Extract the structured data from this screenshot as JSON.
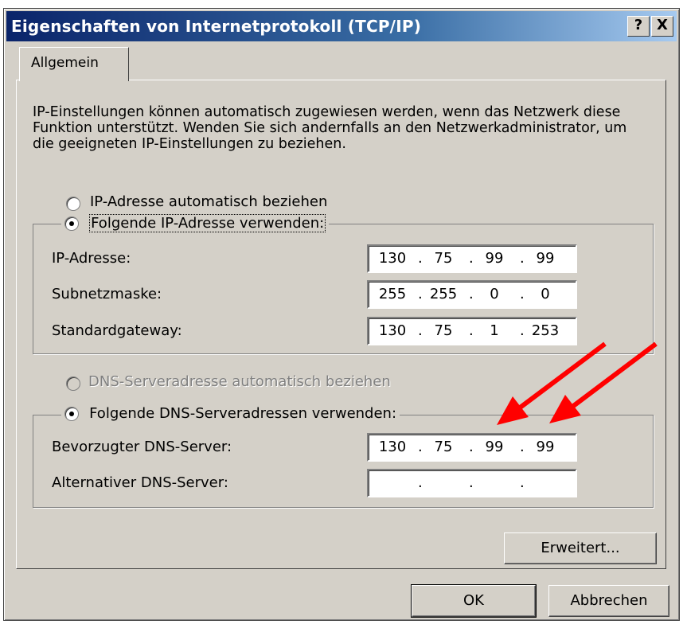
{
  "window": {
    "title": "Eigenschaften von Internetprotokoll (TCP/IP)",
    "help_label": "?",
    "close_label": "X"
  },
  "tab": {
    "label": "Allgemein"
  },
  "description": "IP-Einstellungen können automatisch zugewiesen werden, wenn das Netzwerk diese Funktion unterstützt. Wenden Sie sich andernfalls an den Netzwerkadministrator, um die geeigneten IP-Einstellungen zu beziehen.",
  "ip": {
    "auto_label": "IP-Adresse automatisch beziehen",
    "manual_label": "Folgende IP-Adresse verwenden:",
    "fields": [
      {
        "label": "IP-Adresse:",
        "octets": [
          "130",
          "75",
          "99",
          "99"
        ]
      },
      {
        "label": "Subnetzmaske:",
        "octets": [
          "255",
          "255",
          "0",
          "0"
        ]
      },
      {
        "label": "Standardgateway:",
        "octets": [
          "130",
          "75",
          "1",
          "253"
        ]
      }
    ]
  },
  "dns": {
    "auto_label": "DNS-Serveradresse automatisch beziehen",
    "manual_label": "Folgende DNS-Serveradressen verwenden:",
    "fields": [
      {
        "label": "Bevorzugter DNS-Server:",
        "octets": [
          "130",
          "75",
          "99",
          "99"
        ]
      },
      {
        "label": "Alternativer DNS-Server:",
        "octets": [
          "",
          "",
          "",
          ""
        ]
      }
    ]
  },
  "buttons": {
    "advanced": "Erweitert...",
    "ok": "OK",
    "cancel": "Abbrechen"
  },
  "annotation": {
    "arrow_color": "#ff0000"
  }
}
